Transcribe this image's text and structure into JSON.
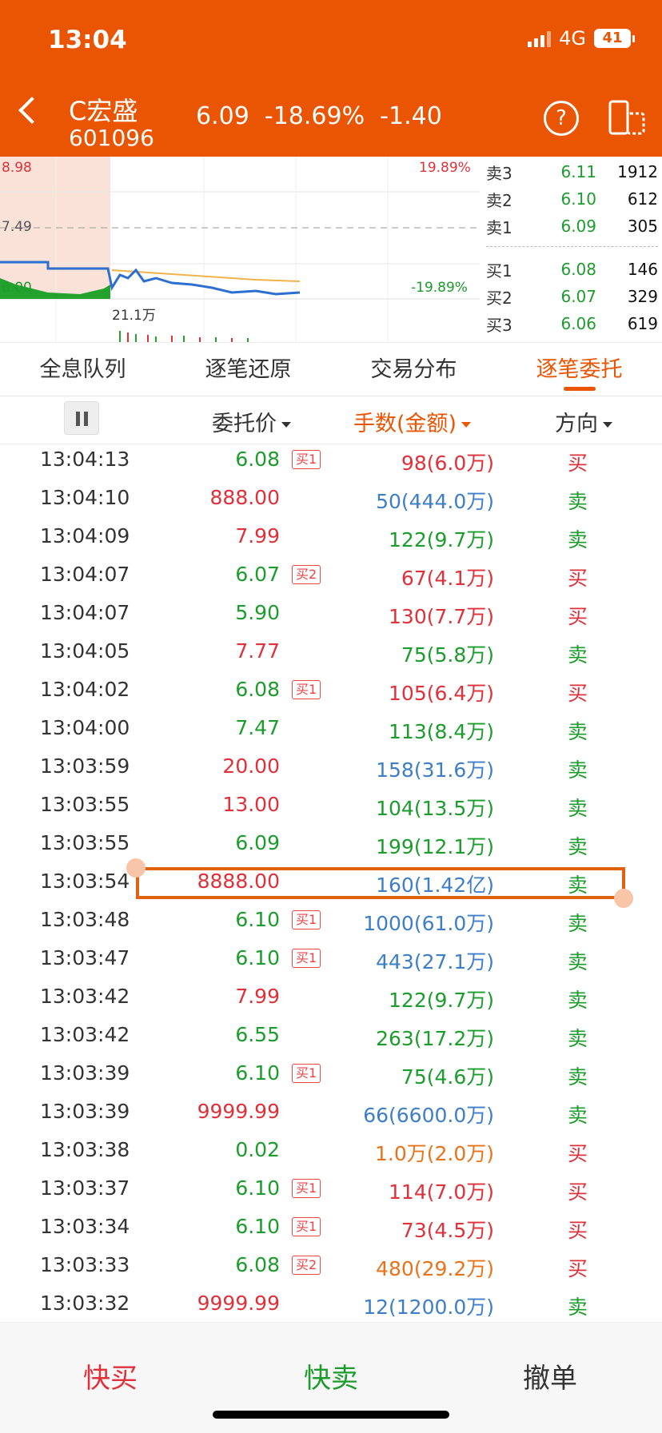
{
  "status_bar": {
    "time": "13:04",
    "network": "4G",
    "battery": "41"
  },
  "stock": {
    "name": "C宏盛",
    "code": "601096",
    "price": "6.09",
    "change_pct": "-18.69%",
    "change": "-1.40"
  },
  "chart_labels": {
    "high": "8.98",
    "mid": "7.49",
    "low": "6.00",
    "up_pct": "19.89%",
    "down_pct": "-19.89%",
    "volume": "21.1万"
  },
  "order_book": {
    "asks": [
      {
        "label": "卖3",
        "price": "6.11",
        "vol": "1912"
      },
      {
        "label": "卖2",
        "price": "6.10",
        "vol": "612"
      },
      {
        "label": "卖1",
        "price": "6.09",
        "vol": "305"
      }
    ],
    "bids": [
      {
        "label": "买1",
        "price": "6.08",
        "vol": "146"
      },
      {
        "label": "买2",
        "price": "6.07",
        "vol": "329"
      },
      {
        "label": "买3",
        "price": "6.06",
        "vol": "619"
      }
    ]
  },
  "tabs": [
    "全息队列",
    "逐笔还原",
    "交易分布",
    "逐笔委托"
  ],
  "columns": {
    "price": "委托价",
    "volume": "手数(金额)",
    "direction": "方向"
  },
  "colors": {
    "accent": "#ea5504",
    "up": "#e0303a",
    "down": "#1b9c2c",
    "blue": "#3e7ec8"
  },
  "rows": [
    {
      "time": "13:04:13",
      "price": "6.08",
      "pc": "g",
      "tag": "买1",
      "vol": "98(6.0万)",
      "vc": "r",
      "dir": "买",
      "dc": "r"
    },
    {
      "time": "13:04:10",
      "price": "888.00",
      "pc": "r",
      "tag": "",
      "vol": "50(444.0万)",
      "vc": "b",
      "dir": "卖",
      "dc": "g"
    },
    {
      "time": "13:04:09",
      "price": "7.99",
      "pc": "r",
      "tag": "",
      "vol": "122(9.7万)",
      "vc": "g",
      "dir": "卖",
      "dc": "g"
    },
    {
      "time": "13:04:07",
      "price": "6.07",
      "pc": "g",
      "tag": "买2",
      "vol": "67(4.1万)",
      "vc": "r",
      "dir": "买",
      "dc": "r"
    },
    {
      "time": "13:04:07",
      "price": "5.90",
      "pc": "g",
      "tag": "",
      "vol": "130(7.7万)",
      "vc": "r",
      "dir": "买",
      "dc": "r"
    },
    {
      "time": "13:04:05",
      "price": "7.77",
      "pc": "r",
      "tag": "",
      "vol": "75(5.8万)",
      "vc": "g",
      "dir": "卖",
      "dc": "g"
    },
    {
      "time": "13:04:02",
      "price": "6.08",
      "pc": "g",
      "tag": "买1",
      "vol": "105(6.4万)",
      "vc": "r",
      "dir": "买",
      "dc": "r"
    },
    {
      "time": "13:04:00",
      "price": "7.47",
      "pc": "g",
      "tag": "",
      "vol": "113(8.4万)",
      "vc": "g",
      "dir": "卖",
      "dc": "g"
    },
    {
      "time": "13:03:59",
      "price": "20.00",
      "pc": "r",
      "tag": "",
      "vol": "158(31.6万)",
      "vc": "b",
      "dir": "卖",
      "dc": "g"
    },
    {
      "time": "13:03:55",
      "price": "13.00",
      "pc": "r",
      "tag": "",
      "vol": "104(13.5万)",
      "vc": "g",
      "dir": "卖",
      "dc": "g"
    },
    {
      "time": "13:03:55",
      "price": "6.09",
      "pc": "g",
      "tag": "",
      "vol": "199(12.1万)",
      "vc": "g",
      "dir": "卖",
      "dc": "g"
    },
    {
      "time": "13:03:54",
      "price": "8888.00",
      "pc": "r",
      "tag": "",
      "vol": "160(1.42亿)",
      "vc": "b",
      "dir": "卖",
      "dc": "g"
    },
    {
      "time": "13:03:48",
      "price": "6.10",
      "pc": "g",
      "tag": "买1",
      "vol": "1000(61.0万)",
      "vc": "b",
      "dir": "卖",
      "dc": "g"
    },
    {
      "time": "13:03:47",
      "price": "6.10",
      "pc": "g",
      "tag": "买1",
      "vol": "443(27.1万)",
      "vc": "b",
      "dir": "卖",
      "dc": "g"
    },
    {
      "time": "13:03:42",
      "price": "7.99",
      "pc": "r",
      "tag": "",
      "vol": "122(9.7万)",
      "vc": "g",
      "dir": "卖",
      "dc": "g"
    },
    {
      "time": "13:03:42",
      "price": "6.55",
      "pc": "g",
      "tag": "",
      "vol": "263(17.2万)",
      "vc": "g",
      "dir": "卖",
      "dc": "g"
    },
    {
      "time": "13:03:39",
      "price": "6.10",
      "pc": "g",
      "tag": "买1",
      "vol": "75(4.6万)",
      "vc": "g",
      "dir": "卖",
      "dc": "g"
    },
    {
      "time": "13:03:39",
      "price": "9999.99",
      "pc": "r",
      "tag": "",
      "vol": "66(6600.0万)",
      "vc": "b",
      "dir": "卖",
      "dc": "g"
    },
    {
      "time": "13:03:38",
      "price": "0.02",
      "pc": "g",
      "tag": "",
      "vol": "1.0万(2.0万)",
      "vc": "o",
      "dir": "买",
      "dc": "r"
    },
    {
      "time": "13:03:37",
      "price": "6.10",
      "pc": "g",
      "tag": "买1",
      "vol": "114(7.0万)",
      "vc": "r",
      "dir": "买",
      "dc": "r"
    },
    {
      "time": "13:03:34",
      "price": "6.10",
      "pc": "g",
      "tag": "买1",
      "vol": "73(4.5万)",
      "vc": "r",
      "dir": "买",
      "dc": "r"
    },
    {
      "time": "13:03:33",
      "price": "6.08",
      "pc": "g",
      "tag": "买2",
      "vol": "480(29.2万)",
      "vc": "o",
      "dir": "买",
      "dc": "r"
    },
    {
      "time": "13:03:32",
      "price": "9999.99",
      "pc": "r",
      "tag": "",
      "vol": "12(1200.0万)",
      "vc": "b",
      "dir": "卖",
      "dc": "g"
    }
  ],
  "actions": {
    "buy": "快买",
    "sell": "快卖",
    "cancel": "撤单"
  }
}
